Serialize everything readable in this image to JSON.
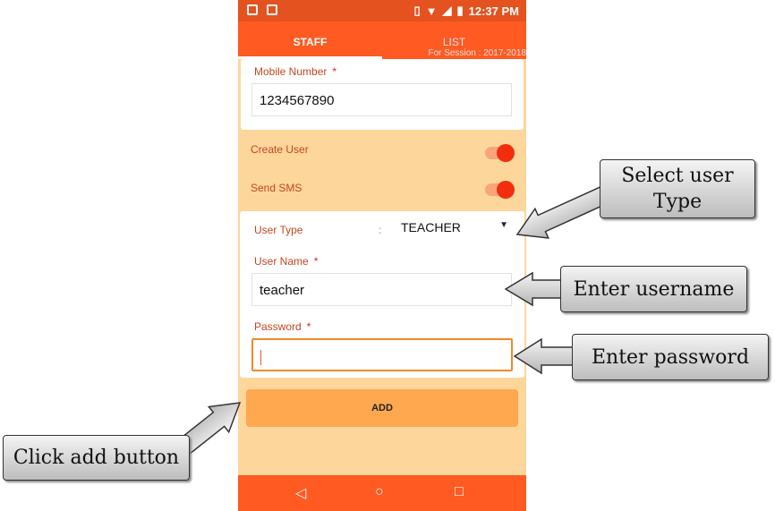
{
  "status_bar": {
    "time": "12:37 PM",
    "icons": [
      "image-icon",
      "gmail-icon",
      "vibrate-icon",
      "wifi-icon",
      "signal-icon",
      "battery-charging-icon"
    ]
  },
  "tabs": [
    {
      "label": "STAFF",
      "active": true
    },
    {
      "label": "LIST",
      "subtitle": "For Session : 2017-2018"
    }
  ],
  "form": {
    "mobile": {
      "label": "Mobile Number",
      "required": "*",
      "value": "1234567890"
    },
    "create_user": {
      "label": "Create User",
      "on": true
    },
    "send_sms": {
      "label": "Send SMS",
      "on": true
    },
    "user_type": {
      "label": "User Type",
      "sep": ":",
      "value": "TEACHER"
    },
    "user_name": {
      "label": "User Name",
      "required": "*",
      "value": "teacher"
    },
    "password": {
      "label": "Password",
      "required": "*",
      "value": ""
    },
    "add_label": "ADD"
  },
  "nav": {
    "back": "◁",
    "home": "○",
    "recents": "□"
  },
  "callouts": {
    "user_type": "Select user Type",
    "username": "Enter username",
    "password": "Enter password",
    "add": "Click add button"
  },
  "colors": {
    "primary": "#fe5a22",
    "status": "#e4521f",
    "background": "#fdd69c",
    "button": "#ffa84f",
    "label": "#c5461f"
  }
}
